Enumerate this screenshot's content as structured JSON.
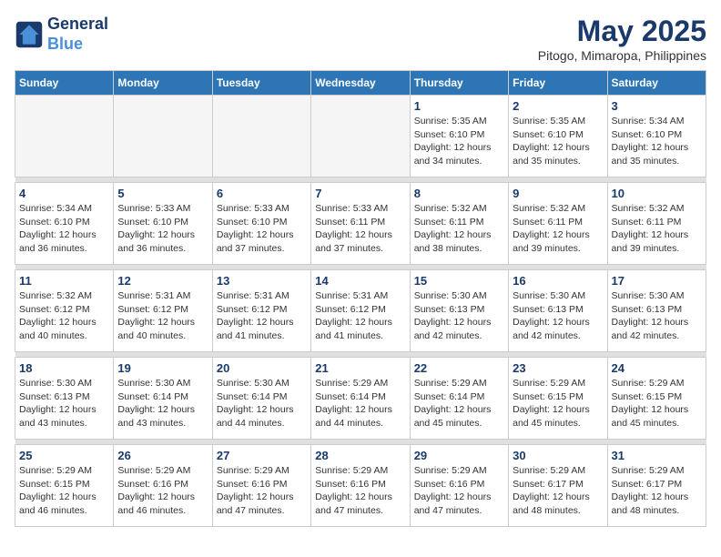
{
  "logo": {
    "line1": "General",
    "line2": "Blue"
  },
  "title": "May 2025",
  "subtitle": "Pitogo, Mimaropa, Philippines",
  "weekdays": [
    "Sunday",
    "Monday",
    "Tuesday",
    "Wednesday",
    "Thursday",
    "Friday",
    "Saturday"
  ],
  "weeks": [
    [
      {
        "day": "",
        "info": ""
      },
      {
        "day": "",
        "info": ""
      },
      {
        "day": "",
        "info": ""
      },
      {
        "day": "",
        "info": ""
      },
      {
        "day": "1",
        "info": "Sunrise: 5:35 AM\nSunset: 6:10 PM\nDaylight: 12 hours\nand 34 minutes."
      },
      {
        "day": "2",
        "info": "Sunrise: 5:35 AM\nSunset: 6:10 PM\nDaylight: 12 hours\nand 35 minutes."
      },
      {
        "day": "3",
        "info": "Sunrise: 5:34 AM\nSunset: 6:10 PM\nDaylight: 12 hours\nand 35 minutes."
      }
    ],
    [
      {
        "day": "4",
        "info": "Sunrise: 5:34 AM\nSunset: 6:10 PM\nDaylight: 12 hours\nand 36 minutes."
      },
      {
        "day": "5",
        "info": "Sunrise: 5:33 AM\nSunset: 6:10 PM\nDaylight: 12 hours\nand 36 minutes."
      },
      {
        "day": "6",
        "info": "Sunrise: 5:33 AM\nSunset: 6:10 PM\nDaylight: 12 hours\nand 37 minutes."
      },
      {
        "day": "7",
        "info": "Sunrise: 5:33 AM\nSunset: 6:11 PM\nDaylight: 12 hours\nand 37 minutes."
      },
      {
        "day": "8",
        "info": "Sunrise: 5:32 AM\nSunset: 6:11 PM\nDaylight: 12 hours\nand 38 minutes."
      },
      {
        "day": "9",
        "info": "Sunrise: 5:32 AM\nSunset: 6:11 PM\nDaylight: 12 hours\nand 39 minutes."
      },
      {
        "day": "10",
        "info": "Sunrise: 5:32 AM\nSunset: 6:11 PM\nDaylight: 12 hours\nand 39 minutes."
      }
    ],
    [
      {
        "day": "11",
        "info": "Sunrise: 5:32 AM\nSunset: 6:12 PM\nDaylight: 12 hours\nand 40 minutes."
      },
      {
        "day": "12",
        "info": "Sunrise: 5:31 AM\nSunset: 6:12 PM\nDaylight: 12 hours\nand 40 minutes."
      },
      {
        "day": "13",
        "info": "Sunrise: 5:31 AM\nSunset: 6:12 PM\nDaylight: 12 hours\nand 41 minutes."
      },
      {
        "day": "14",
        "info": "Sunrise: 5:31 AM\nSunset: 6:12 PM\nDaylight: 12 hours\nand 41 minutes."
      },
      {
        "day": "15",
        "info": "Sunrise: 5:30 AM\nSunset: 6:13 PM\nDaylight: 12 hours\nand 42 minutes."
      },
      {
        "day": "16",
        "info": "Sunrise: 5:30 AM\nSunset: 6:13 PM\nDaylight: 12 hours\nand 42 minutes."
      },
      {
        "day": "17",
        "info": "Sunrise: 5:30 AM\nSunset: 6:13 PM\nDaylight: 12 hours\nand 42 minutes."
      }
    ],
    [
      {
        "day": "18",
        "info": "Sunrise: 5:30 AM\nSunset: 6:13 PM\nDaylight: 12 hours\nand 43 minutes."
      },
      {
        "day": "19",
        "info": "Sunrise: 5:30 AM\nSunset: 6:14 PM\nDaylight: 12 hours\nand 43 minutes."
      },
      {
        "day": "20",
        "info": "Sunrise: 5:30 AM\nSunset: 6:14 PM\nDaylight: 12 hours\nand 44 minutes."
      },
      {
        "day": "21",
        "info": "Sunrise: 5:29 AM\nSunset: 6:14 PM\nDaylight: 12 hours\nand 44 minutes."
      },
      {
        "day": "22",
        "info": "Sunrise: 5:29 AM\nSunset: 6:14 PM\nDaylight: 12 hours\nand 45 minutes."
      },
      {
        "day": "23",
        "info": "Sunrise: 5:29 AM\nSunset: 6:15 PM\nDaylight: 12 hours\nand 45 minutes."
      },
      {
        "day": "24",
        "info": "Sunrise: 5:29 AM\nSunset: 6:15 PM\nDaylight: 12 hours\nand 45 minutes."
      }
    ],
    [
      {
        "day": "25",
        "info": "Sunrise: 5:29 AM\nSunset: 6:15 PM\nDaylight: 12 hours\nand 46 minutes."
      },
      {
        "day": "26",
        "info": "Sunrise: 5:29 AM\nSunset: 6:16 PM\nDaylight: 12 hours\nand 46 minutes."
      },
      {
        "day": "27",
        "info": "Sunrise: 5:29 AM\nSunset: 6:16 PM\nDaylight: 12 hours\nand 47 minutes."
      },
      {
        "day": "28",
        "info": "Sunrise: 5:29 AM\nSunset: 6:16 PM\nDaylight: 12 hours\nand 47 minutes."
      },
      {
        "day": "29",
        "info": "Sunrise: 5:29 AM\nSunset: 6:16 PM\nDaylight: 12 hours\nand 47 minutes."
      },
      {
        "day": "30",
        "info": "Sunrise: 5:29 AM\nSunset: 6:17 PM\nDaylight: 12 hours\nand 48 minutes."
      },
      {
        "day": "31",
        "info": "Sunrise: 5:29 AM\nSunset: 6:17 PM\nDaylight: 12 hours\nand 48 minutes."
      }
    ]
  ]
}
